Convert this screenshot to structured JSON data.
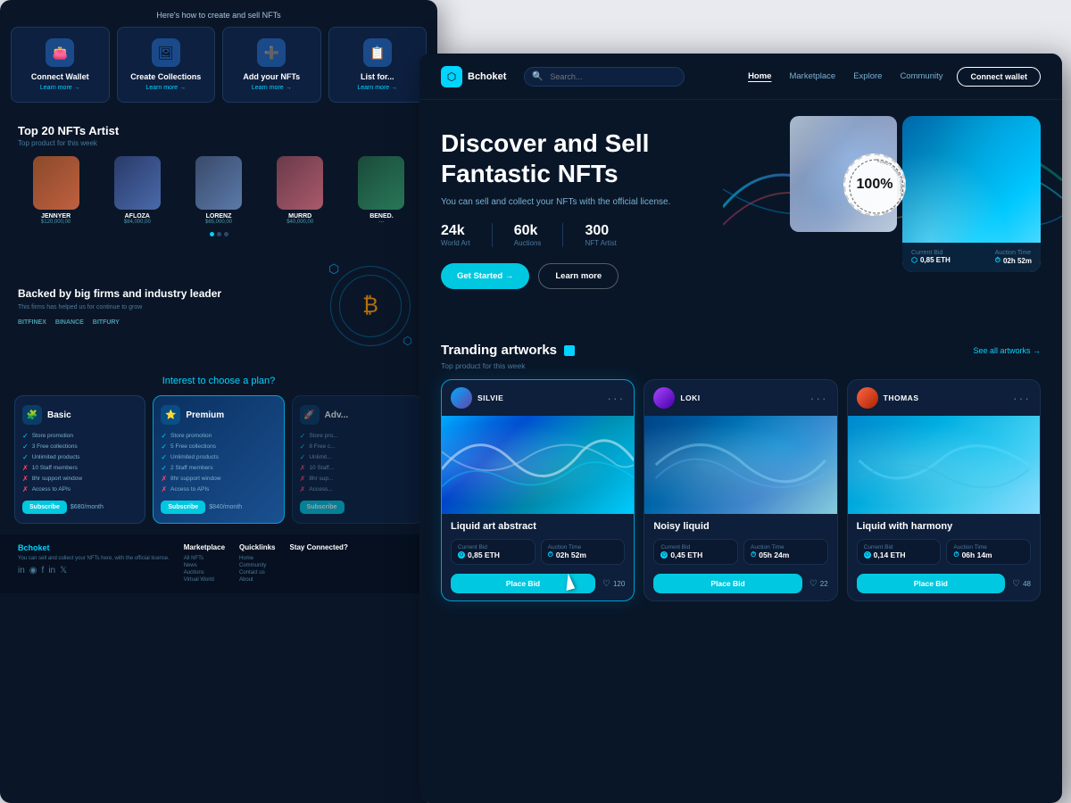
{
  "bg_page": {
    "how_to_text": "Here's how to create and sell NFTs",
    "steps": [
      {
        "icon": "👛",
        "title": "Connect Wallet",
        "link": "Learn more →"
      },
      {
        "icon": "🖼",
        "title": "Create Collections",
        "link": "Learn more →"
      },
      {
        "icon": "➕",
        "title": "Add your NFTs",
        "link": "Learn more →"
      },
      {
        "icon": "📋",
        "title": "List for...",
        "link": "Learn more →"
      }
    ],
    "top_artists_title": "Top 20 NFTs Artist",
    "top_artists_subtitle": "Top product for this week",
    "artists": [
      {
        "name": "JENNYER",
        "price": "$120,000,00",
        "color": "av1"
      },
      {
        "name": "AFLOZA",
        "price": "$84,000,00",
        "color": "av2"
      },
      {
        "name": "LORENZ",
        "price": "$65,000,00",
        "color": "av3"
      },
      {
        "name": "MURRD",
        "price": "$40,000,00",
        "color": "av4"
      },
      {
        "name": "BENED.",
        "price": "---",
        "color": "av5"
      }
    ],
    "backed_title": "Backed by big firms and industry leader",
    "backed_subtitle": "This firms has helped us for continue to grow",
    "logos": [
      "BITFINEX",
      "BINANCE",
      "BITFURY"
    ],
    "pricing_title": "Interest to choose a",
    "pricing_highlight": "plan?",
    "plans": [
      {
        "name": "Basic",
        "icon": "🧩",
        "features": [
          {
            "type": "check",
            "text": "Store promotion"
          },
          {
            "type": "check",
            "text": "3 Free collections"
          },
          {
            "type": "check",
            "text": "Unlimited products"
          },
          {
            "type": "cross",
            "text": "10 Staff members"
          },
          {
            "type": "cross",
            "text": "8hr support window"
          },
          {
            "type": "cross",
            "text": "Access to APIs"
          }
        ],
        "price": "$680",
        "price_period": "/month"
      },
      {
        "name": "Premium",
        "icon": "⭐",
        "featured": true,
        "features": [
          {
            "type": "check",
            "text": "Store promotion"
          },
          {
            "type": "check",
            "text": "5 Free collections"
          },
          {
            "type": "check",
            "text": "Unlimited products"
          },
          {
            "type": "check",
            "text": "2 Staff members"
          },
          {
            "type": "cross",
            "text": "8hr support window"
          },
          {
            "type": "cross",
            "text": "Access to APIs"
          }
        ],
        "price": "$840",
        "price_period": "/month"
      },
      {
        "name": "Adv...",
        "icon": "🚀",
        "partial": true,
        "price": "---"
      }
    ],
    "subscribe_label": "Subscribe",
    "footer": {
      "logo": "Bchoket",
      "tagline": "You can sell and collect your NFTs here, with the official license.",
      "columns": {
        "marketplace": {
          "title": "Marketplace",
          "links": [
            "All NFTs",
            "News",
            "Auctions",
            "Virtual World"
          ]
        },
        "quicklinks": {
          "title": "Quicklinks",
          "links": [
            "Home",
            "Community",
            "Contact us",
            "About"
          ]
        },
        "stay": {
          "title": "Stay Connected?",
          "links": []
        }
      }
    }
  },
  "main_page": {
    "nav": {
      "logo": "Bchoket",
      "search_placeholder": "Search...",
      "links": [
        {
          "label": "Home",
          "active": true
        },
        {
          "label": "Marketplace",
          "active": false
        },
        {
          "label": "Explore",
          "active": false
        },
        {
          "label": "Community",
          "active": false
        }
      ],
      "connect_btn": "Connect wallet"
    },
    "hero": {
      "title_line1": "Discover and Sell",
      "title_line2": "Fantastic NFTs",
      "description": "You can sell and collect your NFTs with the official license.",
      "stats": [
        {
          "value": "24k",
          "label": "World Art"
        },
        {
          "value": "60k",
          "label": "Auctions"
        },
        {
          "value": "300",
          "label": "NFT Artist"
        }
      ],
      "btn_primary": "Get Started →",
      "btn_secondary": "Learn more",
      "trusted_percent": "100%",
      "nft_bid": {
        "current_bid_label": "Current Bid",
        "current_bid_value": "0,85 ETH",
        "auction_time_label": "Auction Time",
        "auction_time_value": "02h 52m"
      }
    },
    "trending": {
      "title": "Tranding artworks",
      "subtitle": "Top product for this week",
      "see_all": "See all artworks →",
      "artworks": [
        {
          "artist": "SILVIE",
          "title": "Liquid art abstract",
          "current_bid_label": "Current Bid",
          "current_bid": "0,85 ETH",
          "auction_label": "Auction Time",
          "auction_time": "02h 52m",
          "place_bid": "Place Bid",
          "likes": "120",
          "avatar_class": "avatar-silvie",
          "img_class": "art-img-silvie",
          "featured": true
        },
        {
          "artist": "LOKI",
          "title": "Noisy liquid",
          "current_bid_label": "Current Bid",
          "current_bid": "0,45 ETH",
          "auction_label": "Auction Time",
          "auction_time": "05h 24m",
          "place_bid": "Place Bid",
          "likes": "22",
          "avatar_class": "avatar-loki",
          "img_class": "art-img-loki",
          "featured": false
        },
        {
          "artist": "THOMAS",
          "title": "Liquid with harmony",
          "current_bid_label": "Current Bid",
          "current_bid": "0,14 ETH",
          "auction_label": "Auction Time",
          "auction_time": "06h 14m",
          "place_bid": "Place Bid",
          "likes": "48",
          "avatar_class": "avatar-thomas",
          "img_class": "art-img-thomas",
          "featured": false
        }
      ]
    }
  }
}
